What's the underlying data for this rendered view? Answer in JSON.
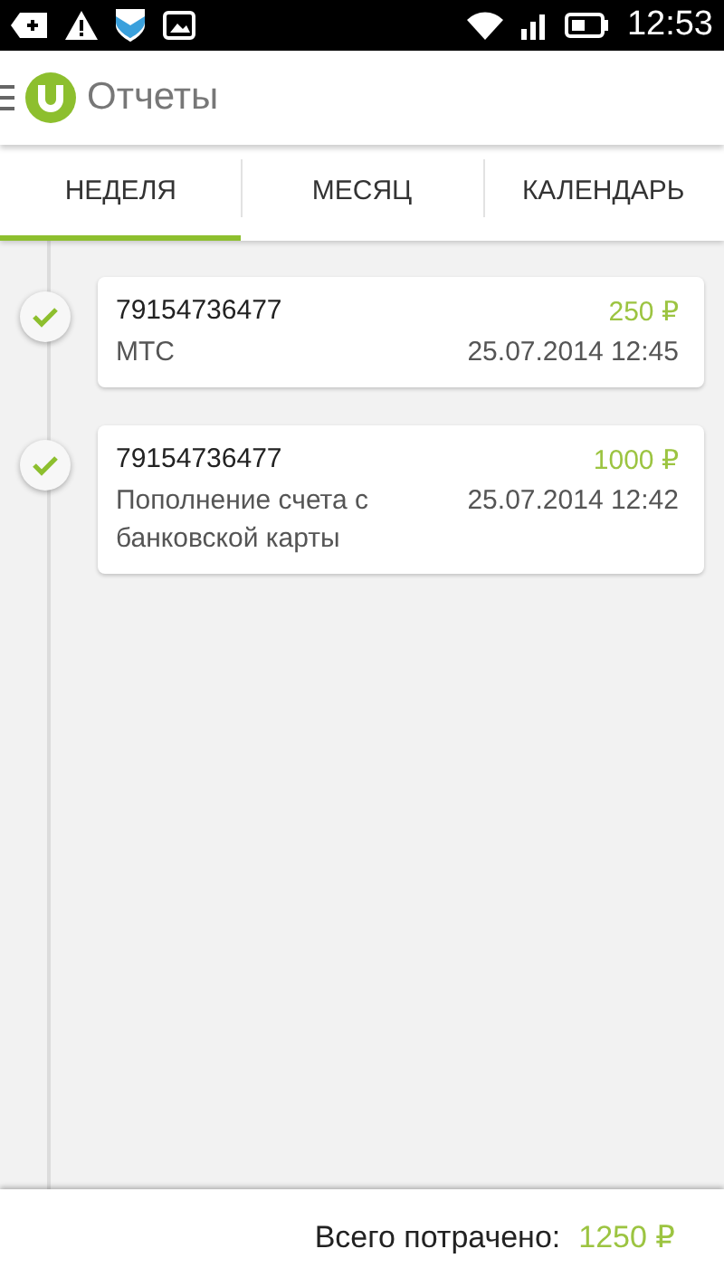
{
  "status_bar": {
    "time": "12:53"
  },
  "app_bar": {
    "title": "Отчеты"
  },
  "tabs": [
    {
      "label": "НЕДЕЛЯ",
      "selected": true
    },
    {
      "label": "МЕСЯЦ",
      "selected": false
    },
    {
      "label": "КАЛЕНДАРЬ",
      "selected": false
    }
  ],
  "transactions": [
    {
      "number": "79154736477",
      "amount": "250 ₽",
      "description": "МТС",
      "datetime": "25.07.2014 12:45",
      "completed": true
    },
    {
      "number": "79154736477",
      "amount": "1000 ₽",
      "description": "Пополнение счета с банковской карты",
      "datetime": "25.07.2014 12:42",
      "completed": true
    }
  ],
  "footer": {
    "label": "Всего потрачено:",
    "total": "1250 ₽"
  }
}
